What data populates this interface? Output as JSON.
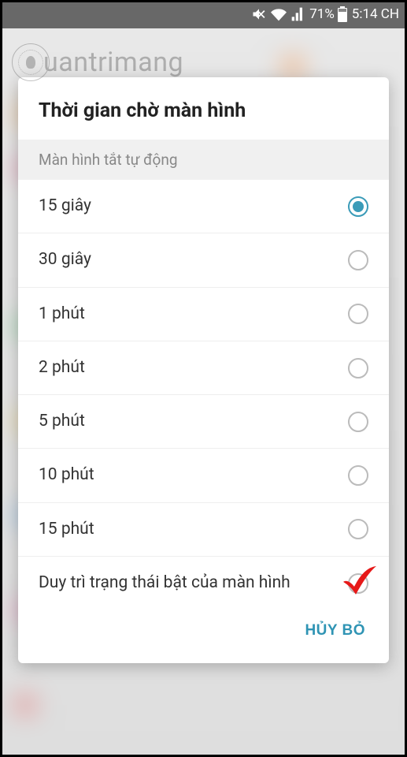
{
  "status_bar": {
    "battery_percent": "71%",
    "time": "5:14 CH"
  },
  "watermark": {
    "text": "uantrimang"
  },
  "dialog": {
    "title": "Thời gian chờ màn hình",
    "section_header": "Màn hình tắt tự động",
    "options": [
      {
        "label": "15 giây",
        "selected": true
      },
      {
        "label": "30 giây",
        "selected": false
      },
      {
        "label": "1 phút",
        "selected": false
      },
      {
        "label": "2 phút",
        "selected": false
      },
      {
        "label": "5 phút",
        "selected": false
      },
      {
        "label": "10 phút",
        "selected": false
      },
      {
        "label": "15 phút",
        "selected": false
      },
      {
        "label": "Duy trì trạng thái bật của màn hình",
        "selected": false,
        "highlighted": true
      }
    ],
    "cancel_label": "HỦY BỎ"
  },
  "colors": {
    "accent": "#3a9bb8",
    "cancel": "#2f94b4",
    "checkmark": "#e61919"
  }
}
